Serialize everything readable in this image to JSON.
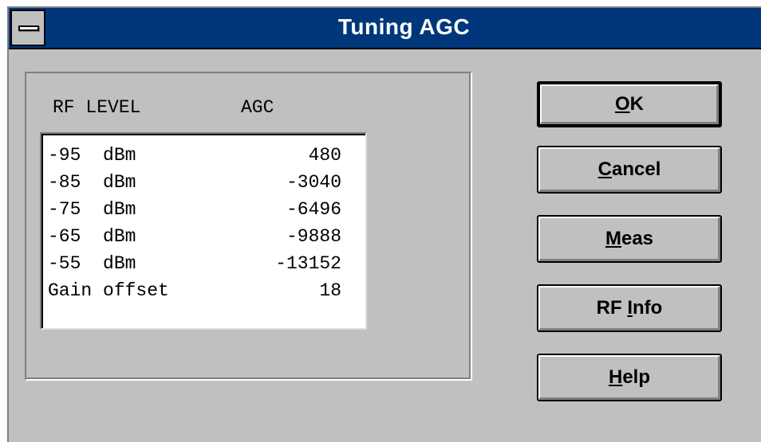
{
  "window": {
    "title": "Tuning AGC"
  },
  "header": {
    "rf_level": "RF LEVEL",
    "agc": "AGC"
  },
  "table": {
    "rows": [
      {
        "label": "-95  dBm",
        "value": "480"
      },
      {
        "label": "-85  dBm",
        "value": "-3040"
      },
      {
        "label": "-75  dBm",
        "value": "-6496"
      },
      {
        "label": "-65  dBm",
        "value": "-9888"
      },
      {
        "label": "-55  dBm",
        "value": "-13152"
      },
      {
        "label": "Gain offset",
        "value": "18"
      }
    ]
  },
  "buttons": {
    "ok": {
      "mnemonic": "O",
      "rest": "K"
    },
    "cancel": {
      "mnemonic": "C",
      "rest": "ancel"
    },
    "meas": {
      "mnemonic": "M",
      "rest": "eas"
    },
    "rfinfo": {
      "pre": "RF ",
      "mnemonic": "I",
      "rest": "nfo"
    },
    "help": {
      "mnemonic": "H",
      "rest": "elp"
    }
  },
  "colors": {
    "titlebar": "#00377b",
    "face": "#c0c0c0"
  }
}
